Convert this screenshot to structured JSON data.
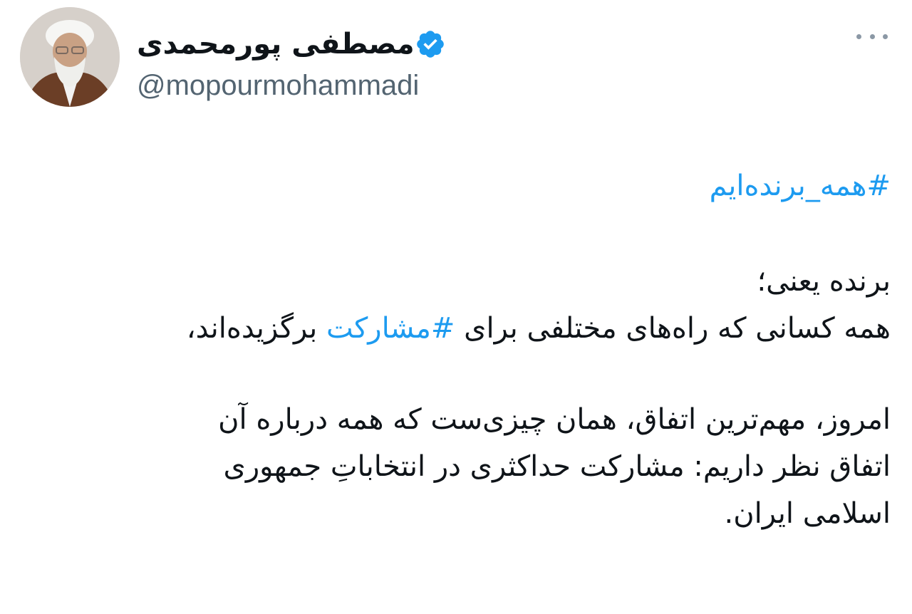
{
  "author": {
    "display_name": "مصطفی پورمحمدی",
    "handle": "@mopourmohammadi",
    "verified": true
  },
  "icons": {
    "verified": "verified-badge-icon",
    "more": "more-horizontal-icon"
  },
  "colors": {
    "link": "#1d9bf0",
    "text": "#0f1419",
    "secondary": "#536471",
    "verified": "#1d9bf0"
  },
  "tweet": {
    "hashtag_top": "#همه_برنده‌ایم",
    "line1": "برنده یعنی؛",
    "line2_before": "همه کسانی که راه‌های مختلفی برای ",
    "line2_hashtag": "#مشارکت",
    "line2_after": " برگزیده‌اند،",
    "line3": "امروز، مهم‌ترین اتفاق، همان چیزی‌ست که همه درباره آن",
    "line4": "اتفاق نظر داریم: مشارکت حداکثری در انتخاباتِ جمهوری",
    "line5": "اسلامی ایران."
  }
}
